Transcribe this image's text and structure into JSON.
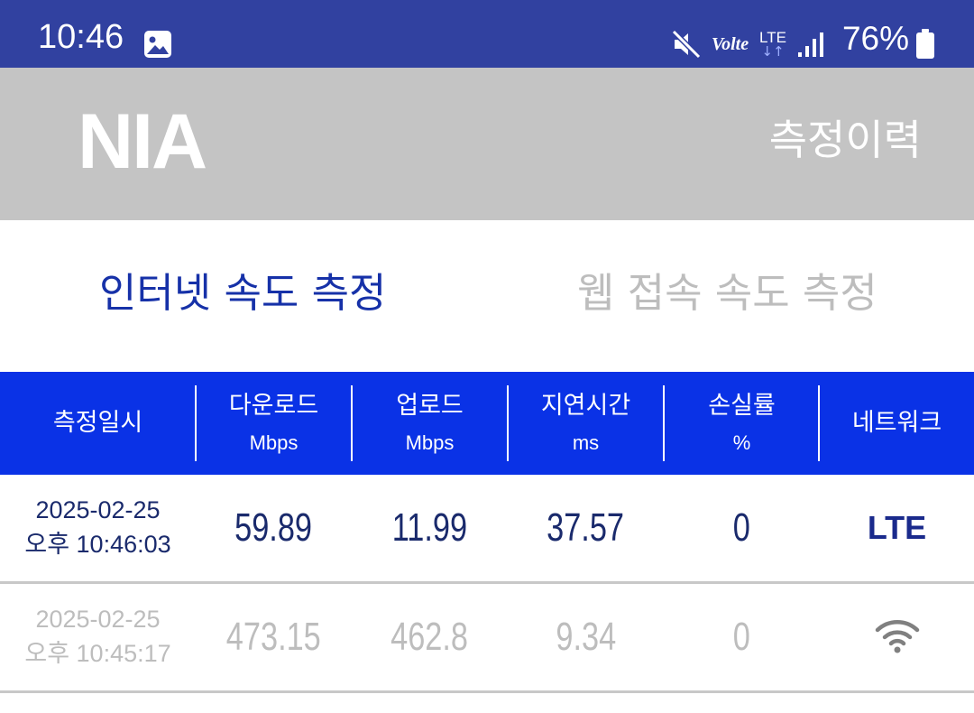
{
  "status_bar": {
    "time": "10:46",
    "volte": "Volte",
    "network": "LTE",
    "battery": "76%"
  },
  "header": {
    "logo": "NIA",
    "history_label": "측정이력"
  },
  "tabs": [
    {
      "label": "인터넷 속도 측정",
      "active": true
    },
    {
      "label": "웹 접속 속도 측정",
      "active": false
    }
  ],
  "table": {
    "columns": [
      {
        "title": "측정일시",
        "unit": ""
      },
      {
        "title": "다운로드",
        "unit": "Mbps"
      },
      {
        "title": "업로드",
        "unit": "Mbps"
      },
      {
        "title": "지연시간",
        "unit": "ms"
      },
      {
        "title": "손실률",
        "unit": "%"
      },
      {
        "title": "네트워크",
        "unit": ""
      }
    ],
    "rows": [
      {
        "date": "2025-02-25",
        "time": "오후 10:46:03",
        "download": "59.89",
        "upload": "11.99",
        "latency": "37.57",
        "loss": "0",
        "network": "LTE",
        "network_icon": "lte-text"
      },
      {
        "date": "2025-02-25",
        "time": "오후 10:45:17",
        "download": "473.15",
        "upload": "462.8",
        "latency": "9.34",
        "loss": "0",
        "network": "",
        "network_icon": "wifi-icon"
      }
    ]
  },
  "colors": {
    "status_bar": "#3141a0",
    "header": "#c4c4c4",
    "table_header": "#0a32e6",
    "active_tab": "#1631a8",
    "inactive": "#bdbdbd"
  }
}
